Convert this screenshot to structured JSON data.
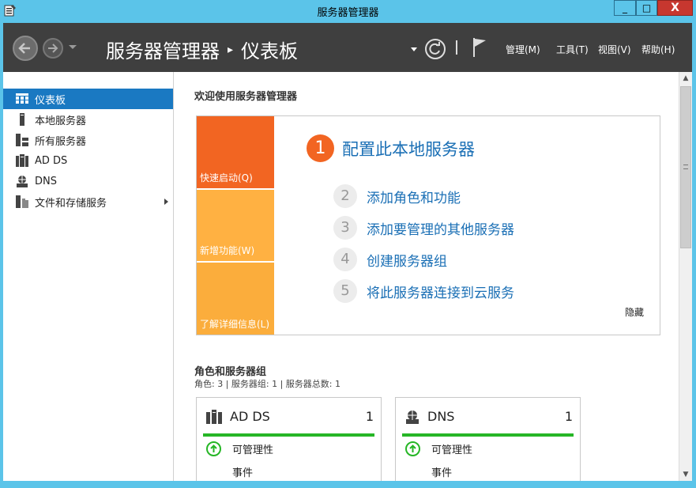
{
  "window": {
    "title": "服务器管理器",
    "controls": {
      "minimize": "_",
      "maximize": "□",
      "close": "X"
    },
    "accent_color": "#5bc4e9"
  },
  "header": {
    "breadcrumb_root": "服务器管理器",
    "breadcrumb_separator": "▸",
    "breadcrumb_current": "仪表板",
    "menus": [
      "管理(M)",
      "工具(T)",
      "视图(V)",
      "帮助(H)"
    ],
    "icons": [
      "back-arrow-icon",
      "forward-arrow-icon",
      "refresh-icon",
      "flag-icon"
    ]
  },
  "sidebar": {
    "items": [
      {
        "label": "仪表板",
        "icon": "dashboard-icon",
        "active": true
      },
      {
        "label": "本地服务器",
        "icon": "local-server-icon"
      },
      {
        "label": "所有服务器",
        "icon": "all-servers-icon"
      },
      {
        "label": "AD DS",
        "icon": "ad-ds-icon"
      },
      {
        "label": "DNS",
        "icon": "dns-icon"
      },
      {
        "label": "文件和存储服务",
        "icon": "file-storage-icon",
        "has_submenu": true
      }
    ],
    "active_color": "#1a79c2"
  },
  "main": {
    "welcome_title": "欢迎使用服务器管理器",
    "tiles": [
      "快速启动(Q)",
      "新增功能(W)",
      "了解详细信息(L)"
    ],
    "tile_colors": [
      "#f26522",
      "#ffb142",
      "#fbad3c"
    ],
    "steps": [
      {
        "num": "1",
        "label": "配置此本地服务器"
      },
      {
        "num": "2",
        "label": "添加角色和功能"
      },
      {
        "num": "3",
        "label": "添加要管理的其他服务器"
      },
      {
        "num": "4",
        "label": "创建服务器组"
      },
      {
        "num": "5",
        "label": "将此服务器连接到云服务"
      }
    ],
    "hide_link": "隐藏",
    "roles_title": "角色和服务器组",
    "roles_summary": "角色: 3 | 服务器组: 1 | 服务器总数: 1",
    "cards": [
      {
        "name": "AD DS",
        "count": "1",
        "icon": "ad-ds-icon",
        "rows": [
          "可管理性",
          "事件"
        ],
        "status_color": "#26b626"
      },
      {
        "name": "DNS",
        "count": "1",
        "icon": "dns-icon",
        "rows": [
          "可管理性",
          "事件"
        ],
        "status_color": "#26b626"
      }
    ]
  }
}
